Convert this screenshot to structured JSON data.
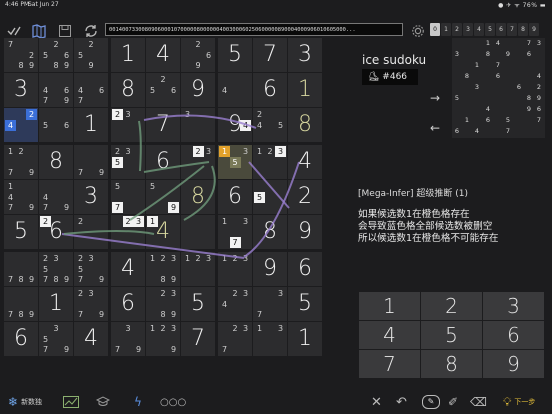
{
  "status": {
    "time": "4:46 PM",
    "date": "Sat Jun 27",
    "indicators": "●  ✈ ᯤ 76% ▬"
  },
  "toolbar": {
    "puzzle_string": "0014007330080906000107000008000000400300060250600000890004000906010605000...",
    "digits": [
      "0",
      "1",
      "2",
      "3",
      "4",
      "5",
      "6",
      "7",
      "8",
      "9"
    ],
    "selected_digit": "0"
  },
  "grid": {
    "cells": [
      {
        "r": 0,
        "c": 0,
        "cands": [
          [
            "7",
            ""
          ],
          [
            "2",
            ""
          ],
          [
            "8",
            ""
          ],
          [
            "9",
            ""
          ]
        ],
        "n": [
          {
            "d": "7",
            "p": "tl"
          },
          {
            "d": "2",
            "p": "mr"
          },
          {
            "d": "8",
            "p": "bm"
          },
          {
            "d": "9",
            "p": "br"
          }
        ]
      },
      {
        "r": 0,
        "c": 1,
        "n": [
          {
            "d": "2",
            "p": "tm"
          },
          {
            "d": "5",
            "p": "ml"
          },
          {
            "d": "6",
            "p": "mr"
          },
          {
            "d": "8",
            "p": "bm"
          },
          {
            "d": "9",
            "p": "br"
          }
        ]
      },
      {
        "r": 0,
        "c": 2,
        "n": [
          {
            "d": "2",
            "p": "tm"
          },
          {
            "d": "5",
            "p": "ml"
          },
          {
            "d": "9",
            "p": "bm"
          }
        ]
      },
      {
        "r": 0,
        "c": 3,
        "v": "1"
      },
      {
        "r": 0,
        "c": 4,
        "v": "4"
      },
      {
        "r": 0,
        "c": 5,
        "n": [
          {
            "d": "2",
            "p": "tm"
          },
          {
            "d": "6",
            "p": "mr"
          },
          {
            "d": "9",
            "p": "bm"
          }
        ]
      },
      {
        "r": 0,
        "c": 6,
        "v": "5"
      },
      {
        "r": 0,
        "c": 7,
        "v": "7"
      },
      {
        "r": 0,
        "c": 8,
        "v": "3"
      },
      {
        "r": 1,
        "c": 0,
        "v": "3"
      },
      {
        "r": 1,
        "c": 1,
        "n": [
          {
            "d": "4",
            "p": "ml"
          },
          {
            "d": "6",
            "p": "mr"
          },
          {
            "d": "7",
            "p": "bl"
          },
          {
            "d": "9",
            "p": "br"
          }
        ]
      },
      {
        "r": 1,
        "c": 2,
        "n": [
          {
            "d": "4",
            "p": "ml"
          },
          {
            "d": "6",
            "p": "mr"
          },
          {
            "d": "7",
            "p": "bl"
          }
        ]
      },
      {
        "r": 1,
        "c": 3,
        "v": "8"
      },
      {
        "r": 1,
        "c": 4,
        "n": [
          {
            "d": "2",
            "p": "tm"
          },
          {
            "d": "5",
            "p": "ml"
          },
          {
            "d": "6",
            "p": "mr"
          }
        ]
      },
      {
        "r": 1,
        "c": 5,
        "v": "9"
      },
      {
        "r": 1,
        "c": 6,
        "n": [
          {
            "d": "4",
            "p": "ml"
          }
        ]
      },
      {
        "r": 1,
        "c": 7,
        "v": "6"
      },
      {
        "r": 1,
        "c": 8,
        "v": "1",
        "cls": "user"
      },
      {
        "r": 2,
        "c": 0,
        "hl": "blue",
        "n": [
          {
            "d": "2",
            "p": "tr",
            "box": "b"
          },
          {
            "d": "4",
            "p": "ml",
            "box": "b"
          }
        ]
      },
      {
        "r": 2,
        "c": 1,
        "n": [
          {
            "d": "5",
            "p": "ml"
          },
          {
            "d": "6",
            "p": "mr"
          }
        ]
      },
      {
        "r": 2,
        "c": 2,
        "v": "1"
      },
      {
        "r": 2,
        "c": 3,
        "n": [
          {
            "d": "2",
            "p": "tl",
            "box": "w"
          },
          {
            "d": "3",
            "p": "tm"
          }
        ]
      },
      {
        "r": 2,
        "c": 4,
        "v": "7"
      },
      {
        "r": 2,
        "c": 5,
        "n": [
          {
            "d": "3",
            "p": "tl"
          }
        ]
      },
      {
        "r": 2,
        "c": 6,
        "v": "9",
        "n": [
          {
            "d": "4",
            "p": "mr",
            "box": "w"
          }
        ]
      },
      {
        "r": 2,
        "c": 7,
        "n": [
          {
            "d": "2",
            "p": "tl"
          },
          {
            "d": "4",
            "p": "ml"
          },
          {
            "d": "5",
            "p": "mr"
          }
        ]
      },
      {
        "r": 2,
        "c": 8,
        "v": "8",
        "cls": "user"
      },
      {
        "r": 3,
        "c": 0,
        "n": [
          {
            "d": "1",
            "p": "tl"
          },
          {
            "d": "2",
            "p": "tm"
          },
          {
            "d": "7",
            "p": "bl"
          },
          {
            "d": "9",
            "p": "br"
          }
        ]
      },
      {
        "r": 3,
        "c": 1,
        "v": "8"
      },
      {
        "r": 3,
        "c": 2,
        "n": [
          {
            "d": "7",
            "p": "bl"
          },
          {
            "d": "9",
            "p": "br"
          }
        ]
      },
      {
        "r": 3,
        "c": 3,
        "n": [
          {
            "d": "2",
            "p": "tl"
          },
          {
            "d": "3",
            "p": "tm"
          },
          {
            "d": "5",
            "p": "ml",
            "box": "w"
          }
        ]
      },
      {
        "r": 3,
        "c": 4,
        "v": "6"
      },
      {
        "r": 3,
        "c": 5,
        "n": [
          {
            "d": "2",
            "p": "tm",
            "box": "w"
          },
          {
            "d": "3",
            "p": "tr"
          }
        ]
      },
      {
        "r": 3,
        "c": 6,
        "hl": "green",
        "n": [
          {
            "d": "1",
            "p": "tl",
            "box": "o"
          },
          {
            "d": "3",
            "p": "tr"
          },
          {
            "d": "5",
            "p": "mm",
            "box": "g"
          }
        ]
      },
      {
        "r": 3,
        "c": 7,
        "n": [
          {
            "d": "1",
            "p": "tl"
          },
          {
            "d": "2",
            "p": "tm"
          },
          {
            "d": "3",
            "p": "tr",
            "box": "w"
          }
        ]
      },
      {
        "r": 3,
        "c": 8,
        "v": "4"
      },
      {
        "r": 4,
        "c": 0,
        "n": [
          {
            "d": "1",
            "p": "tl"
          },
          {
            "d": "4",
            "p": "ml"
          },
          {
            "d": "7",
            "p": "bl"
          },
          {
            "d": "9",
            "p": "br"
          }
        ]
      },
      {
        "r": 4,
        "c": 1,
        "n": [
          {
            "d": "4",
            "p": "ml"
          },
          {
            "d": "7",
            "p": "bl"
          },
          {
            "d": "9",
            "p": "br"
          }
        ]
      },
      {
        "r": 4,
        "c": 2,
        "v": "3"
      },
      {
        "r": 4,
        "c": 3,
        "n": [
          {
            "d": "5",
            "p": "tl"
          },
          {
            "d": "7",
            "p": "bl",
            "box": "w"
          }
        ]
      },
      {
        "r": 4,
        "c": 4,
        "n": [
          {
            "d": "5",
            "p": "tl"
          },
          {
            "d": "9",
            "p": "br",
            "box": "w"
          }
        ]
      },
      {
        "r": 4,
        "c": 5,
        "v": "8",
        "cls": "user"
      },
      {
        "r": 4,
        "c": 6,
        "v": "6"
      },
      {
        "r": 4,
        "c": 7,
        "n": [
          {
            "d": "5",
            "p": "ml",
            "box": "w"
          }
        ]
      },
      {
        "r": 4,
        "c": 8,
        "v": "2"
      },
      {
        "r": 5,
        "c": 0,
        "v": "5"
      },
      {
        "r": 5,
        "c": 1,
        "v": "6",
        "n": [
          {
            "d": "2",
            "p": "tl",
            "box": "w"
          }
        ]
      },
      {
        "r": 5,
        "c": 2,
        "n": [
          {
            "d": "2",
            "p": "tl"
          }
        ]
      },
      {
        "r": 5,
        "c": 3,
        "n": [
          {
            "d": "2",
            "p": "tm",
            "box": "w"
          },
          {
            "d": "3",
            "p": "tr",
            "box": "w"
          }
        ]
      },
      {
        "r": 5,
        "c": 4,
        "v": "4",
        "cls": "user",
        "n": [
          {
            "d": "1",
            "p": "tl",
            "box": "w"
          }
        ]
      },
      {
        "r": 5,
        "c": 5,
        "n": []
      },
      {
        "r": 5,
        "c": 6,
        "n": [
          {
            "d": "1",
            "p": "tl"
          },
          {
            "d": "3",
            "p": "tr"
          },
          {
            "d": "7",
            "p": "bm",
            "box": "w"
          }
        ]
      },
      {
        "r": 5,
        "c": 7,
        "v": "8"
      },
      {
        "r": 5,
        "c": 8,
        "v": "9"
      },
      {
        "r": 6,
        "c": 0,
        "n": [
          {
            "d": "7",
            "p": "bl"
          },
          {
            "d": "8",
            "p": "bm"
          },
          {
            "d": "9",
            "p": "br"
          }
        ]
      },
      {
        "r": 6,
        "c": 1,
        "n": [
          {
            "d": "2",
            "p": "tl"
          },
          {
            "d": "3",
            "p": "tm"
          },
          {
            "d": "5",
            "p": "ml"
          },
          {
            "d": "7",
            "p": "bl"
          },
          {
            "d": "8",
            "p": "bm"
          },
          {
            "d": "9",
            "p": "br"
          }
        ]
      },
      {
        "r": 6,
        "c": 2,
        "n": [
          {
            "d": "2",
            "p": "tl"
          },
          {
            "d": "3",
            "p": "tm"
          },
          {
            "d": "5",
            "p": "ml"
          },
          {
            "d": "7",
            "p": "bl"
          },
          {
            "d": "9",
            "p": "br"
          }
        ]
      },
      {
        "r": 6,
        "c": 3,
        "v": "4"
      },
      {
        "r": 6,
        "c": 4,
        "n": [
          {
            "d": "1",
            "p": "tl"
          },
          {
            "d": "2",
            "p": "tm"
          },
          {
            "d": "3",
            "p": "tr"
          },
          {
            "d": "8",
            "p": "bm"
          },
          {
            "d": "9",
            "p": "br"
          }
        ]
      },
      {
        "r": 6,
        "c": 5,
        "n": [
          {
            "d": "1",
            "p": "tl"
          },
          {
            "d": "2",
            "p": "tm"
          },
          {
            "d": "3",
            "p": "tr"
          }
        ]
      },
      {
        "r": 6,
        "c": 6,
        "n": [
          {
            "d": "1",
            "p": "tl"
          },
          {
            "d": "2",
            "p": "tm"
          },
          {
            "d": "3",
            "p": "tr"
          }
        ]
      },
      {
        "r": 6,
        "c": 7,
        "v": "9"
      },
      {
        "r": 6,
        "c": 8,
        "v": "6"
      },
      {
        "r": 7,
        "c": 0,
        "n": [
          {
            "d": "7",
            "p": "bl"
          },
          {
            "d": "8",
            "p": "bm"
          },
          {
            "d": "9",
            "p": "br"
          }
        ]
      },
      {
        "r": 7,
        "c": 1,
        "v": "1"
      },
      {
        "r": 7,
        "c": 2,
        "n": [
          {
            "d": "2",
            "p": "tl"
          },
          {
            "d": "3",
            "p": "tm"
          },
          {
            "d": "7",
            "p": "bl"
          },
          {
            "d": "9",
            "p": "br"
          }
        ]
      },
      {
        "r": 7,
        "c": 3,
        "v": "6"
      },
      {
        "r": 7,
        "c": 4,
        "n": [
          {
            "d": "2",
            "p": "tm"
          },
          {
            "d": "3",
            "p": "tr"
          },
          {
            "d": "8",
            "p": "bm"
          },
          {
            "d": "9",
            "p": "br"
          }
        ]
      },
      {
        "r": 7,
        "c": 5,
        "v": "5"
      },
      {
        "r": 7,
        "c": 6,
        "n": [
          {
            "d": "2",
            "p": "tm"
          },
          {
            "d": "3",
            "p": "tr"
          },
          {
            "d": "4",
            "p": "ml"
          }
        ]
      },
      {
        "r": 7,
        "c": 7,
        "n": [
          {
            "d": "3",
            "p": "tr"
          },
          {
            "d": "7",
            "p": "bl"
          }
        ]
      },
      {
        "r": 7,
        "c": 8,
        "v": "5"
      },
      {
        "r": 8,
        "c": 0,
        "v": "6"
      },
      {
        "r": 8,
        "c": 1,
        "n": [
          {
            "d": "3",
            "p": "tm"
          },
          {
            "d": "5",
            "p": "ml"
          },
          {
            "d": "7",
            "p": "bl"
          },
          {
            "d": "9",
            "p": "br"
          }
        ]
      },
      {
        "r": 8,
        "c": 2,
        "v": "4"
      },
      {
        "r": 8,
        "c": 3,
        "n": [
          {
            "d": "3",
            "p": "tm"
          },
          {
            "d": "7",
            "p": "bl"
          },
          {
            "d": "9",
            "p": "br"
          }
        ]
      },
      {
        "r": 8,
        "c": 4,
        "n": [
          {
            "d": "1",
            "p": "tl"
          },
          {
            "d": "2",
            "p": "tm"
          },
          {
            "d": "3",
            "p": "tr"
          },
          {
            "d": "9",
            "p": "br"
          }
        ]
      },
      {
        "r": 8,
        "c": 5,
        "v": "7"
      },
      {
        "r": 8,
        "c": 6,
        "n": [
          {
            "d": "2",
            "p": "tm"
          },
          {
            "d": "3",
            "p": "tr"
          },
          {
            "d": "7",
            "p": "bl"
          }
        ]
      },
      {
        "r": 8,
        "c": 7,
        "n": [
          {
            "d": "1",
            "p": "tl"
          },
          {
            "d": "3",
            "p": "tr"
          }
        ]
      },
      {
        "r": 8,
        "c": 8,
        "v": "1"
      }
    ]
  },
  "sidebar": {
    "title": "ice sudoku",
    "puzzle_number": "#466",
    "explanation_title": "[Mega-Infer] 超级推断 (1)",
    "explanation_lines": [
      "如果候选数1在橙色格存在",
      "会导致蓝色格全部候选数被删空",
      "所以候选数1在橙色格不可能存在"
    ]
  },
  "mini_grid": [
    [
      "",
      "",
      "",
      "1",
      "4",
      "",
      "",
      "7",
      "3"
    ],
    [
      "3",
      "",
      "",
      "8",
      "",
      "9",
      "",
      "6",
      ""
    ],
    [
      "",
      "",
      "1",
      "",
      "7",
      "",
      "",
      "",
      ""
    ],
    [
      "",
      "8",
      "",
      "",
      "6",
      "",
      "",
      "",
      "4"
    ],
    [
      "",
      "",
      "3",
      "",
      "",
      "",
      "6",
      "",
      "2"
    ],
    [
      "5",
      "",
      "",
      "",
      "",
      "",
      "",
      "8",
      "9"
    ],
    [
      "",
      "",
      "",
      "4",
      "",
      "",
      "",
      "9",
      "6"
    ],
    [
      "",
      "1",
      "",
      "6",
      "",
      "5",
      "",
      "",
      "7"
    ],
    [
      "6",
      "",
      "4",
      "",
      "",
      "7",
      "",
      "",
      ""
    ]
  ],
  "keypad": [
    "1",
    "2",
    "3",
    "4",
    "5",
    "6",
    "7",
    "8",
    "9"
  ],
  "bottom": {
    "new_game_label": "新数独",
    "next_label": "下一步"
  },
  "colors": {
    "orange": "#e2a12b",
    "blue": "#3b6fd8",
    "link_purple": "#9a7fd0",
    "link_green": "#6f9b7a"
  }
}
